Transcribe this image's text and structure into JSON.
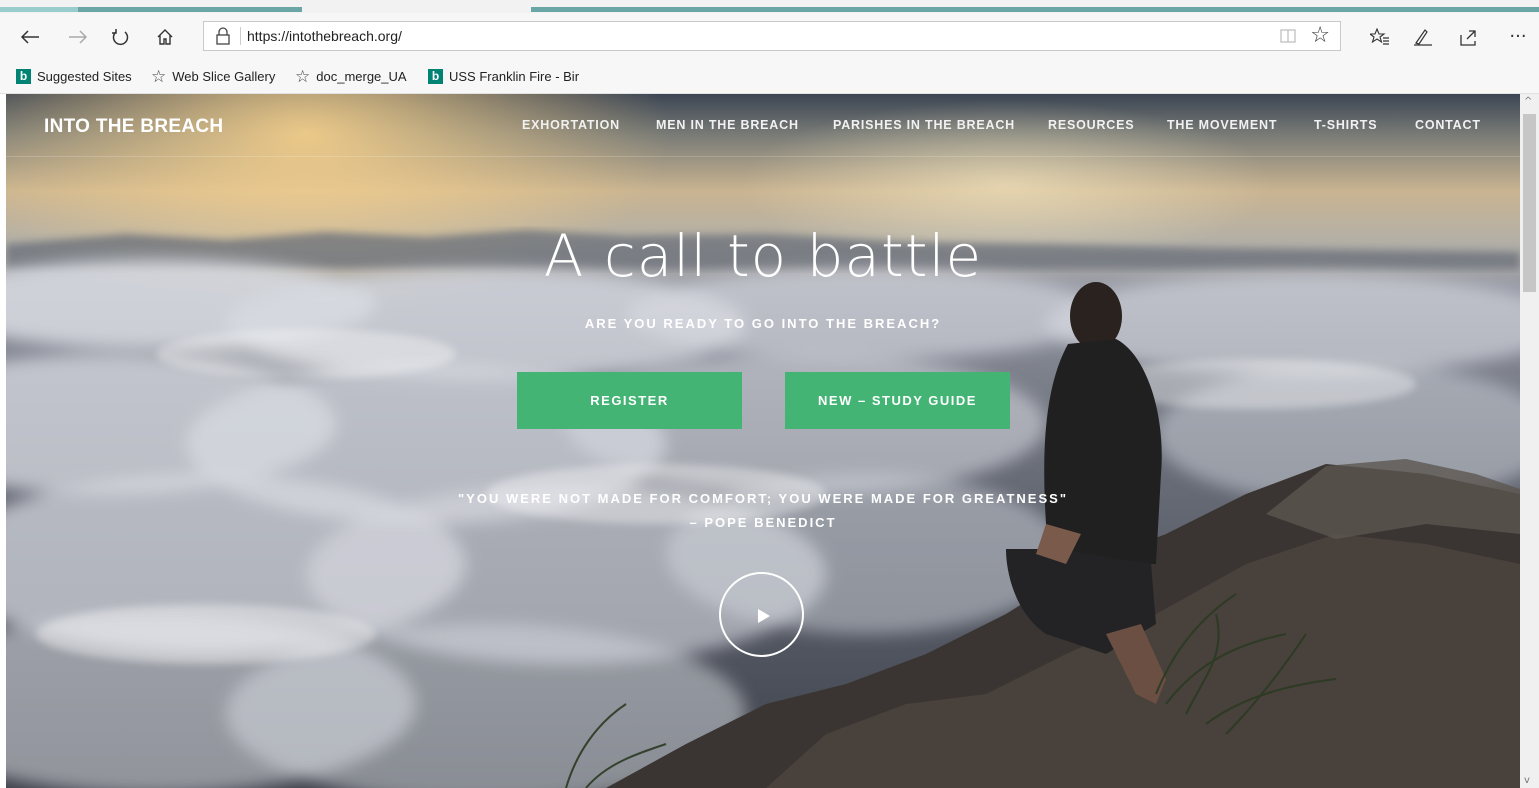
{
  "browser": {
    "url": "https://intothebreach.org/",
    "favorites": [
      {
        "label": "Suggested Sites",
        "icon": "bing-icon"
      },
      {
        "label": "Web Slice Gallery",
        "icon": "star-outline-icon"
      },
      {
        "label": "doc_merge_UA",
        "icon": "star-outline-icon"
      },
      {
        "label": "USS Franklin Fire - Bir",
        "icon": "bing-icon"
      }
    ],
    "more_label": "···"
  },
  "site": {
    "logo": "INTO THE BREACH",
    "nav": [
      "EXHORTATION",
      "MEN IN THE BREACH",
      "PARISHES IN THE BREACH",
      "RESOURCES",
      "THE MOVEMENT",
      "T-SHIRTS",
      "CONTACT"
    ]
  },
  "hero": {
    "title": "A call to battle",
    "subtitle": "ARE YOU READY TO GO INTO THE BREACH?",
    "buttons": [
      "REGISTER",
      "NEW – STUDY GUIDE"
    ],
    "quote": "\"YOU WERE NOT MADE FOR COMFORT; YOU WERE MADE FOR GREATNESS\"",
    "quote_by": "– POPE BENEDICT"
  },
  "colors": {
    "accent_green": "#43b474",
    "tab_accent": "#6aa6a6"
  }
}
